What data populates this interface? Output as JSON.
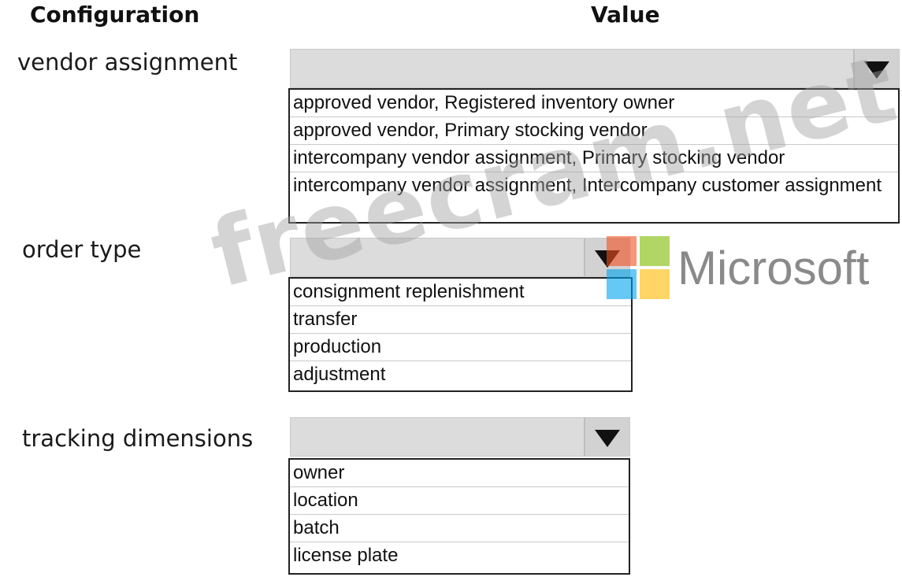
{
  "headers": {
    "configuration": "Configuration",
    "value": "Value"
  },
  "rows": [
    {
      "label": "vendor assignment",
      "options": [
        "approved vendor, Registered inventory owner",
        "approved vendor, Primary stocking vendor",
        "intercompany vendor assignment, Primary stocking vendor",
        "intercompany vendor assignment, Intercompany customer assignment"
      ]
    },
    {
      "label": "order type",
      "options": [
        "consignment replenishment",
        "transfer",
        "production",
        "adjustment"
      ]
    },
    {
      "label": "tracking dimensions",
      "options": [
        "owner",
        "location",
        "batch",
        "license plate"
      ]
    }
  ],
  "watermark": {
    "text": "freecram.net",
    "brand": "Microsoft",
    "logo_colors": [
      "#f25022",
      "#7fba00",
      "#00a4ef",
      "#ffb900"
    ]
  }
}
